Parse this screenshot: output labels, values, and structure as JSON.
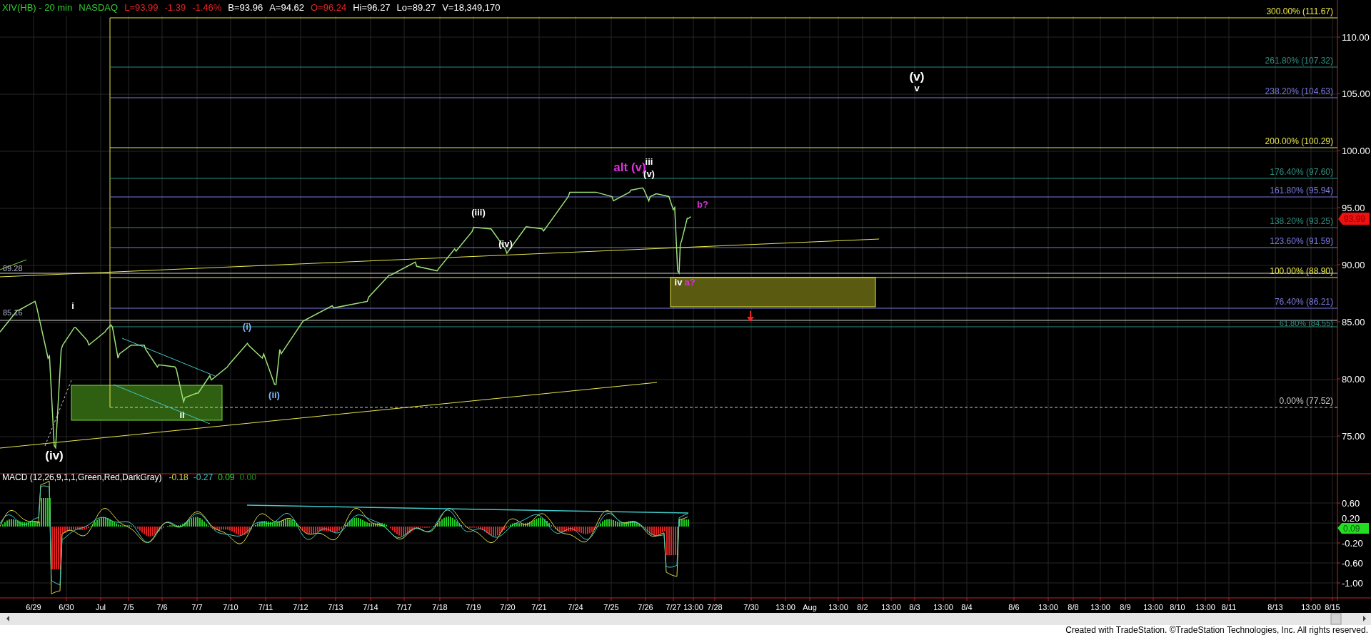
{
  "header": {
    "fields": [
      {
        "text": "XIV(HB) - 20 min",
        "color": "#33cc33"
      },
      {
        "text": "NASDAQ",
        "color": "#33cc33"
      },
      {
        "text": "L=93.99",
        "color": "#ee2222"
      },
      {
        "text": "-1.39",
        "color": "#ee2222"
      },
      {
        "text": "-1.46%",
        "color": "#ee2222"
      },
      {
        "text": "B=93.96",
        "color": "#ffffff"
      },
      {
        "text": "A=94.62",
        "color": "#ffffff"
      },
      {
        "text": "O=96.24",
        "color": "#ee2222"
      },
      {
        "text": "Hi=96.27",
        "color": "#ffffff"
      },
      {
        "text": "Lo=89.27",
        "color": "#ffffff"
      },
      {
        "text": "V=18,349,170",
        "color": "#ffffff"
      }
    ]
  },
  "price_axis": {
    "ticks": [
      "110.00",
      "105.00",
      "100.00",
      "95.00",
      "90.00",
      "85.00",
      "80.00",
      "75.00"
    ],
    "last_price": "93.99"
  },
  "fib_levels": [
    {
      "label": "300.00% (111.67)",
      "color": "#e8e84a"
    },
    {
      "label": "261.80% (107.32)",
      "color": "#2f8f80"
    },
    {
      "label": "238.20% (104.63)",
      "color": "#7a7ae0"
    },
    {
      "label": "200.00% (100.29)",
      "color": "#e8e84a"
    },
    {
      "label": "176.40% (97.60)",
      "color": "#2f8f80"
    },
    {
      "label": "161.80% (95.94)",
      "color": "#7a7ae0"
    },
    {
      "label": "138.20% (93.25)",
      "color": "#2f8f80"
    },
    {
      "label": "123.60% (91.59)",
      "color": "#7a7ae0"
    },
    {
      "label": "100.00% (88.90)",
      "color": "#e8e84a"
    },
    {
      "label": "76.40% (86.21)",
      "color": "#7a7ae0"
    },
    {
      "label": "61.80% (84.55)",
      "color": "#2f8f80"
    },
    {
      "label": "0.00% (77.52)",
      "color": "#c8c8c8"
    }
  ],
  "left_labels": [
    "89.28",
    "85.16"
  ],
  "wave_labels": [
    {
      "text": "(iv)",
      "color": "#ffffff",
      "kind": "major"
    },
    {
      "text": "i",
      "color": "#ffffff",
      "kind": "minor"
    },
    {
      "text": "ii",
      "color": "#ffffff",
      "kind": "minor"
    },
    {
      "text": "(i)",
      "color": "#7fb8ff",
      "kind": "minor"
    },
    {
      "text": "(ii)",
      "color": "#7fb8ff",
      "kind": "minor"
    },
    {
      "text": "(iii)",
      "color": "#ffffff",
      "kind": "minor"
    },
    {
      "text": "(iv)",
      "color": "#ffffff",
      "kind": "minor"
    },
    {
      "text": "alt (v)",
      "color": "#dd33dd",
      "kind": "major"
    },
    {
      "text": "iii",
      "color": "#ffffff",
      "kind": "minor"
    },
    {
      "text": "(v)",
      "color": "#ffffff",
      "kind": "minor"
    },
    {
      "text": "b?",
      "color": "#dd33dd",
      "kind": "minor"
    },
    {
      "text": "iv",
      "color": "#ffffff",
      "kind": "minor"
    },
    {
      "text": "a?",
      "color": "#dd33dd",
      "kind": "minor"
    },
    {
      "text": "(v)",
      "color": "#ffffff",
      "kind": "major"
    },
    {
      "text": "v",
      "color": "#ffffff",
      "kind": "minor"
    }
  ],
  "macd": {
    "title": "MACD (12,26,9,1,1,Green,Red,DarkGray)",
    "values": [
      {
        "text": "-0.18",
        "color": "#d8d84a"
      },
      {
        "text": "-0.27",
        "color": "#40c8c8"
      },
      {
        "text": "0.09",
        "color": "#33dd33"
      },
      {
        "text": "0.00",
        "color": "#1f8f1f"
      }
    ],
    "axis_ticks": [
      "0.60",
      "0.20",
      "-0.20",
      "-0.60",
      "-1.00"
    ],
    "last_value": "0.09"
  },
  "time_axis": {
    "labels": [
      "6/29",
      "6/30",
      "Jul",
      "7/5",
      "7/6",
      "7/7",
      "7/10",
      "7/11",
      "7/12",
      "7/13",
      "7/14",
      "7/17",
      "7/18",
      "7/19",
      "7/20",
      "7/21",
      "7/24",
      "7/25",
      "7/26",
      "7/27",
      "13:00",
      "7/28",
      "7/30",
      "13:00",
      "Aug",
      "13:00",
      "8/2",
      "13:00",
      "8/3",
      "13:00",
      "8/4",
      "8/6",
      "13:00",
      "8/8",
      "13:00",
      "8/9",
      "13:00",
      "8/10",
      "13:00",
      "8/11",
      "8/13",
      "13:00",
      "8/15"
    ]
  },
  "footer": "Created with TradeStation. ©TradeStation Technologies, Inc. All rights reserved."
}
